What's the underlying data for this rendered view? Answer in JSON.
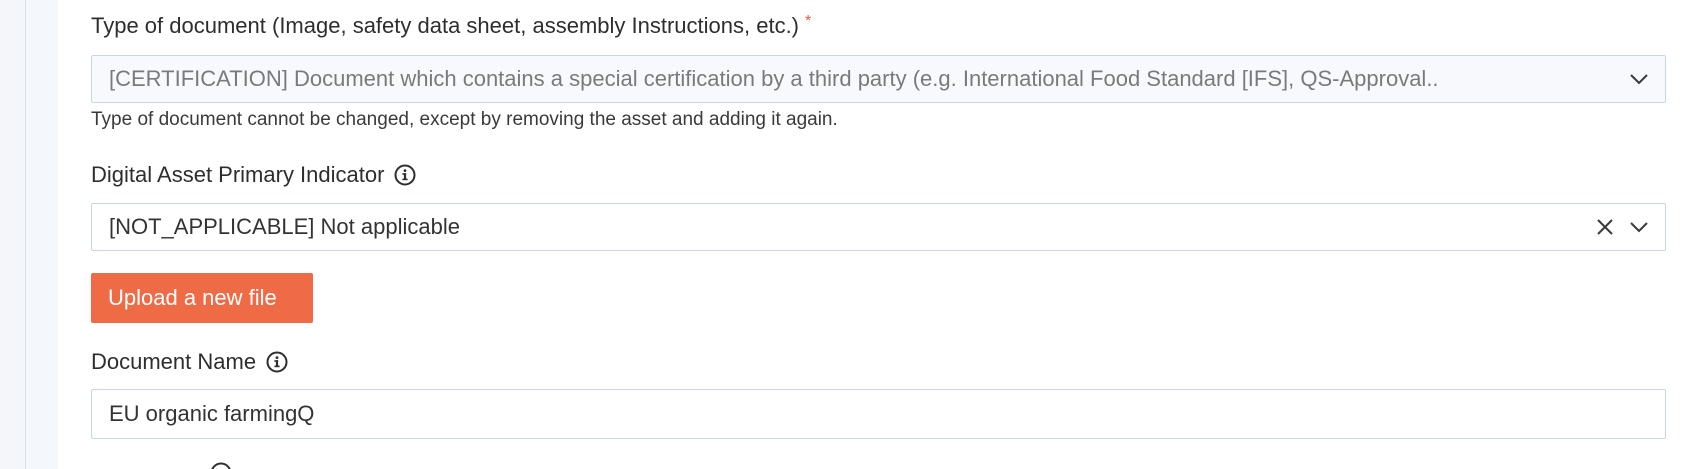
{
  "fields": {
    "document_type": {
      "label": "Type of document (Image, safety data sheet, assembly Instructions, etc.)",
      "required_marker": "*",
      "value": "[CERTIFICATION] Document which contains a special certification by a third party (e.g. International Food Standard [IFS], QS-Approval..",
      "help": "Type of document cannot be changed, except by removing the asset and adding it again.",
      "disabled": true,
      "icons": [
        "chevron-down-icon"
      ]
    },
    "primary_indicator": {
      "label": "Digital Asset Primary Indicator",
      "value": "[NOT_APPLICABLE] Not applicable",
      "icons": [
        "info-icon",
        "clear-icon",
        "chevron-down-icon"
      ]
    },
    "upload": {
      "label": "Upload a new file"
    },
    "document_name": {
      "label": "Document Name",
      "value": "EU organic farmingQ",
      "icons": [
        "info-icon"
      ]
    }
  },
  "colors": {
    "accent": "#ef6b45",
    "required": "#e85a3c",
    "border": "#c9d6e6"
  }
}
